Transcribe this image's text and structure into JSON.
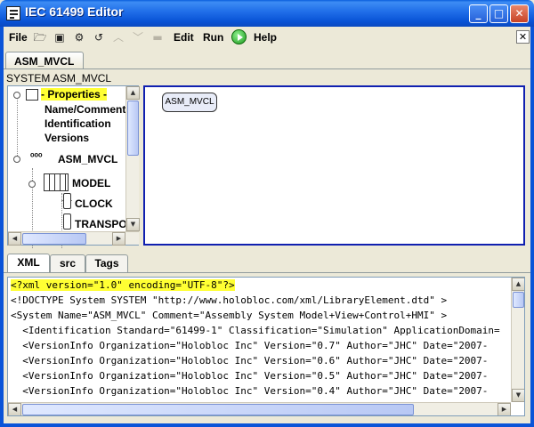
{
  "window": {
    "title": "IEC 61499 Editor"
  },
  "menubar": {
    "file": "File",
    "edit": "Edit",
    "run": "Run",
    "help": "Help",
    "close_glyph": "✕"
  },
  "system_tab": {
    "label": "ASM_MVCL"
  },
  "system_label": "SYSTEM ASM_MVCL",
  "tree": {
    "properties": "- Properties -",
    "name_comment": "Name/Comment",
    "identification": "Identification",
    "versions": "Versions",
    "device": "ASM_MVCL",
    "resource": "MODEL",
    "fb1": "CLOCK",
    "fb2": "TRANSPO"
  },
  "canvas": {
    "system_node": "ASM_MVCL"
  },
  "bottom_tabs": [
    "XML",
    "src",
    "Tags"
  ],
  "xml": {
    "lines": [
      "<?xml version=\"1.0\" encoding=\"UTF-8\"?>",
      "<!DOCTYPE System SYSTEM \"http://www.holobloc.com/xml/LibraryElement.dtd\" >",
      "<System Name=\"ASM_MVCL\" Comment=\"Assembly System Model+View+Control+HMI\" >",
      "  <Identification Standard=\"61499-1\" Classification=\"Simulation\" ApplicationDomain=",
      "  <VersionInfo Organization=\"Holobloc Inc\" Version=\"0.7\" Author=\"JHC\" Date=\"2007-",
      "  <VersionInfo Organization=\"Holobloc Inc\" Version=\"0.6\" Author=\"JHC\" Date=\"2007-",
      "  <VersionInfo Organization=\"Holobloc Inc\" Version=\"0.5\" Author=\"JHC\" Date=\"2007-",
      "  <VersionInfo Organization=\"Holobloc Inc\" Version=\"0.4\" Author=\"JHC\" Date=\"2007-"
    ]
  },
  "colors": {
    "title_bar": "#0a54d8",
    "highlight": "#ffff33",
    "canvas_border": "#1020b0",
    "run_icon": "#1e9c1e"
  },
  "icons": {
    "toolbar": [
      "open-folder-icon",
      "save-icon",
      "save-as-icon",
      "undo-icon",
      "move-up-icon",
      "move-down-icon",
      "delete-icon"
    ],
    "run": "run-play-icon"
  }
}
